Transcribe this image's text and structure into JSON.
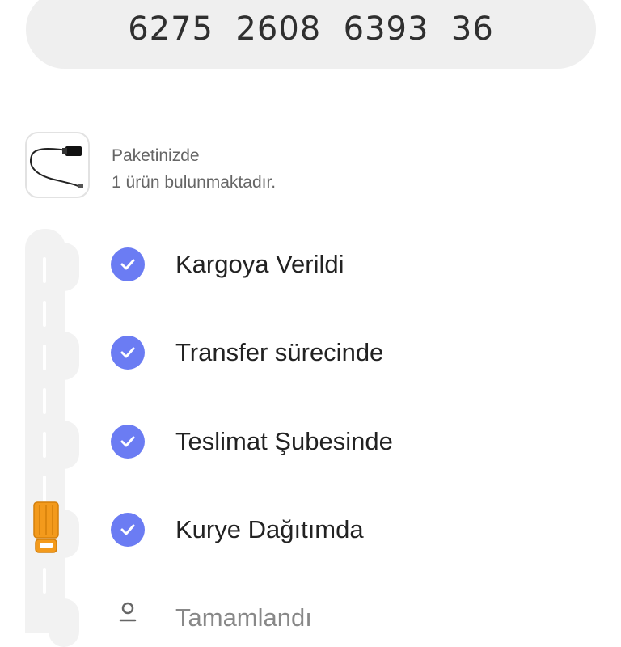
{
  "tracking": {
    "number": "6275  2608  6393  36"
  },
  "package": {
    "line1": "Paketinizde",
    "line2": "1 ürün bulunmaktadır.",
    "image_icon": "cable-icon"
  },
  "steps": [
    {
      "label": "Kargoya Verildi",
      "status": "done"
    },
    {
      "label": "Transfer sürecinde",
      "status": "done"
    },
    {
      "label": "Teslimat Şubesinde",
      "status": "done"
    },
    {
      "label": "Kurye Dağıtımda",
      "status": "done"
    },
    {
      "label": "Tamamlandı",
      "status": "pending"
    }
  ],
  "colors": {
    "accent": "#6b7cf3",
    "truck": "#f39a1c",
    "road": "#f2f2f2"
  }
}
